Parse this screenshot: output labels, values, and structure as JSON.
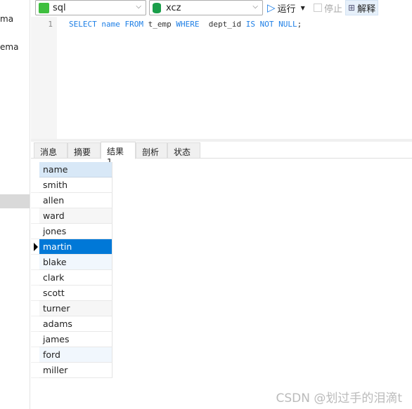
{
  "sidebar": {
    "items": [
      {
        "label": "ma"
      },
      {
        "label": "ema"
      }
    ]
  },
  "toolbar": {
    "connection": "sql",
    "database": "xcz",
    "run_label": "运行",
    "stop_label": "停止",
    "explain_label": "解释"
  },
  "editor": {
    "line_number": "1",
    "tokens": [
      {
        "t": "SELECT",
        "k": true
      },
      {
        "t": " ",
        "k": false
      },
      {
        "t": "name",
        "k": true
      },
      {
        "t": " ",
        "k": false
      },
      {
        "t": "FROM",
        "k": true
      },
      {
        "t": " t_emp ",
        "k": false
      },
      {
        "t": "WHERE",
        "k": true
      },
      {
        "t": "  dept_id ",
        "k": false
      },
      {
        "t": "IS",
        "k": true
      },
      {
        "t": " ",
        "k": false
      },
      {
        "t": "NOT",
        "k": true
      },
      {
        "t": " ",
        "k": false
      },
      {
        "t": "NULL",
        "k": true
      },
      {
        "t": ";",
        "k": false
      }
    ]
  },
  "tabs": [
    {
      "label": "消息"
    },
    {
      "label": "摘要"
    },
    {
      "label": "结果 1",
      "active": true
    },
    {
      "label": "剖析"
    },
    {
      "label": "状态"
    }
  ],
  "results": {
    "column": "name",
    "rows": [
      "smith",
      "allen",
      "ward",
      "jones",
      "martin",
      "blake",
      "clark",
      "scott",
      "turner",
      "adams",
      "james",
      "ford",
      "miller"
    ],
    "selected_row": "martin"
  },
  "watermark": "CSDN @划过手的泪滴t",
  "colors": {
    "selection": "#0078d7",
    "keyword": "#1e7fe6",
    "header": "#d8e8f7"
  }
}
